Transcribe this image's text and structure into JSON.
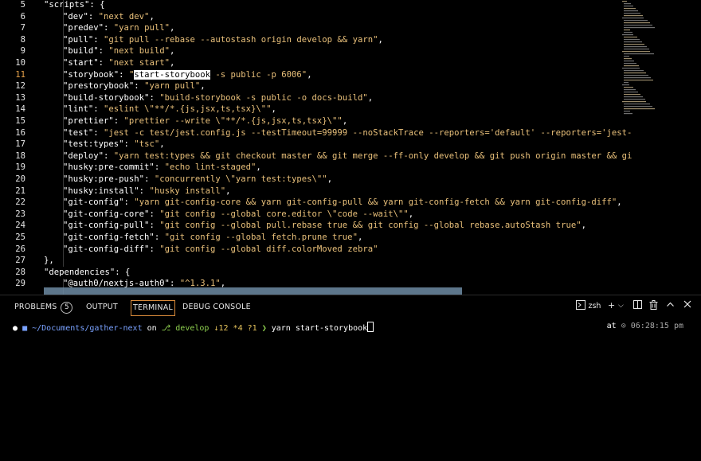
{
  "editor": {
    "active_line": 11,
    "lines": [
      {
        "n": "5",
        "indent": 1,
        "text": "\"scripts\": {"
      },
      {
        "n": "6",
        "indent": 2,
        "key": "\"dev\"",
        "val": "\"next dev\"",
        "end": ","
      },
      {
        "n": "7",
        "indent": 2,
        "key": "\"predev\"",
        "val": "\"yarn pull\"",
        "end": ","
      },
      {
        "n": "8",
        "indent": 2,
        "key": "\"pull\"",
        "val": "\"git pull --rebase --autostash origin develop && yarn\"",
        "end": ","
      },
      {
        "n": "9",
        "indent": 2,
        "key": "\"build\"",
        "val": "\"next build\"",
        "end": ","
      },
      {
        "n": "10",
        "indent": 2,
        "key": "\"start\"",
        "val": "\"next start\"",
        "end": ","
      },
      {
        "n": "11",
        "indent": 2,
        "key": "\"storybook\"",
        "val_pre": "\"",
        "val_hl": "start-storybook",
        "val": " -s public -p 6006\"",
        "end": ","
      },
      {
        "n": "12",
        "indent": 2,
        "key": "\"prestorybook\"",
        "val": "\"yarn pull\"",
        "end": ","
      },
      {
        "n": "13",
        "indent": 2,
        "key": "\"build-storybook\"",
        "val": "\"build-storybook -s public -o docs-build\"",
        "end": ","
      },
      {
        "n": "14",
        "indent": 2,
        "key": "\"lint\"",
        "val": "\"eslint \\\"**/*.{js,jsx,ts,tsx}\\\"\"",
        "end": ","
      },
      {
        "n": "15",
        "indent": 2,
        "key": "\"prettier\"",
        "val": "\"prettier --write \\\"**/*.{js,jsx,ts,tsx}\\\"\"",
        "end": ","
      },
      {
        "n": "16",
        "indent": 2,
        "key": "\"test\"",
        "val": "\"jest -c test/jest.config.js --testTimeout=99999 --noStackTrace --reporters='default' --reporters='jest-",
        "end": ""
      },
      {
        "n": "17",
        "indent": 2,
        "key": "\"test:types\"",
        "val": "\"tsc\"",
        "end": ","
      },
      {
        "n": "18",
        "indent": 2,
        "key": "\"deploy\"",
        "val": "\"yarn test:types && git checkout master && git merge --ff-only develop && git push origin master && gi",
        "end": ""
      },
      {
        "n": "19",
        "indent": 2,
        "key": "\"husky:pre-commit\"",
        "val": "\"echo lint-staged\"",
        "end": ","
      },
      {
        "n": "20",
        "indent": 2,
        "key": "\"husky:pre-push\"",
        "val": "\"concurrently \\\"yarn test:types\\\"\"",
        "end": ","
      },
      {
        "n": "21",
        "indent": 2,
        "key": "\"husky:install\"",
        "val": "\"husky install\"",
        "end": ","
      },
      {
        "n": "22",
        "indent": 2,
        "key": "\"git-config\"",
        "val": "\"yarn git-config-core && yarn git-config-pull && yarn git-config-fetch && yarn git-config-diff\"",
        "end": ","
      },
      {
        "n": "23",
        "indent": 2,
        "key": "\"git-config-core\"",
        "val": "\"git config --global core.editor \\\"code --wait\\\"\"",
        "end": ","
      },
      {
        "n": "24",
        "indent": 2,
        "key": "\"git-config-pull\"",
        "val": "\"git config --global pull.rebase true && git config --global rebase.autoStash true\"",
        "end": ","
      },
      {
        "n": "25",
        "indent": 2,
        "key": "\"git-config-fetch\"",
        "val": "\"git config --global fetch.prune true\"",
        "end": ","
      },
      {
        "n": "26",
        "indent": 2,
        "key": "\"git-config-diff\"",
        "val": "\"git config --global diff.colorMoved zebra\"",
        "end": ""
      },
      {
        "n": "27",
        "indent": 1,
        "text": "},"
      },
      {
        "n": "28",
        "indent": 1,
        "text": "\"dependencies\": {"
      },
      {
        "n": "29",
        "indent": 2,
        "key": "\"@auth0/nextjs-auth0\"",
        "val": "\"^1.3.1\"",
        "end": ","
      }
    ]
  },
  "panel": {
    "tabs": {
      "problems": "PROBLEMS",
      "problems_count": "5",
      "output": "OUTPUT",
      "terminal": "TERMINAL",
      "debug_console": "DEBUG CONSOLE"
    },
    "shell_label": "zsh",
    "icons": [
      "terminal-icon",
      "plus-icon",
      "chevron-down-icon",
      "split-icon",
      "trash-icon",
      "chevron-up-icon",
      "close-icon"
    ]
  },
  "terminal": {
    "path": "~/Documents/gather-next",
    "on": "on",
    "branch": "develop",
    "status": "↓12 *4 ?1",
    "arrow": "❯",
    "command": "yarn start-storybook",
    "at": "at",
    "time": "06:28:15 pm"
  },
  "colors": {
    "string": "#e9c07a",
    "accent_border": "#d98a3a",
    "selection": "#6d8ba3",
    "branch": "#8fd14f"
  }
}
